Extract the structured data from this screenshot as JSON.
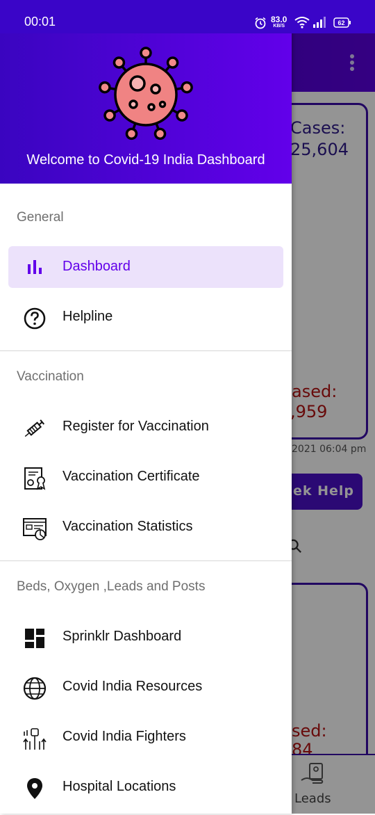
{
  "status_bar": {
    "time": "00:01",
    "network_speed": "83.0",
    "network_unit": "KB/S",
    "battery": "62"
  },
  "background": {
    "card1_title": "Cases:",
    "card1_value": "25,604",
    "card1_label": "ased:",
    "card1_label_value": ",959",
    "updated_text": "2021 06:04 pm",
    "help_button": "ek Help",
    "card2_label": "sed:",
    "card2_value": "84",
    "bottom_nav_label": "Leads"
  },
  "drawer": {
    "welcome": "Welcome to Covid-19 India Dashboard",
    "sections": [
      {
        "title": "General",
        "items": [
          {
            "label": "Dashboard",
            "icon": "bar-chart-icon",
            "active": true
          },
          {
            "label": "Helpline",
            "icon": "help-circle-icon"
          }
        ]
      },
      {
        "title": "Vaccination",
        "items": [
          {
            "label": "Register for Vaccination",
            "icon": "syringe-icon"
          },
          {
            "label": "Vaccination Certificate",
            "icon": "certificate-icon"
          },
          {
            "label": "Vaccination Statistics",
            "icon": "statistics-icon"
          }
        ]
      },
      {
        "title": "Beds, Oxygen ,Leads and Posts",
        "items": [
          {
            "label": "Sprinklr Dashboard",
            "icon": "dashboard-grid-icon"
          },
          {
            "label": "Covid India Resources",
            "icon": "globe-icon"
          },
          {
            "label": "Covid India Fighters",
            "icon": "raised-fists-icon"
          },
          {
            "label": "Hospital Locations",
            "icon": "location-pin-icon"
          }
        ]
      }
    ]
  },
  "colors": {
    "primary": "#6200ea",
    "header_dark": "#3a05c0",
    "active_bg": "#ece2fb"
  }
}
